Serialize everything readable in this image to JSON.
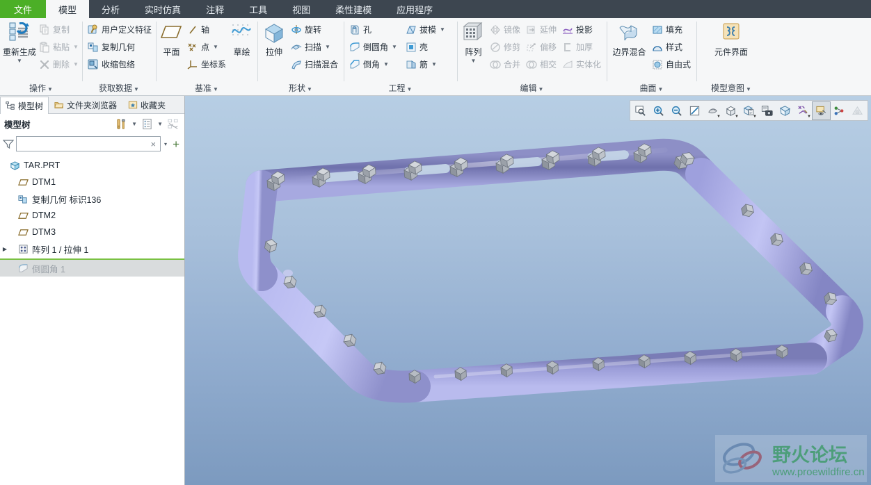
{
  "app": {
    "accent_green": "#4caf27",
    "tabbar_bg": "#3d4650",
    "ribbon_bg": "#f6f7f8",
    "insert_line_color": "#7ac143"
  },
  "tabs": [
    {
      "label": "文件",
      "kind": "file"
    },
    {
      "label": "模型",
      "kind": "active"
    },
    {
      "label": "分析",
      "kind": "normal"
    },
    {
      "label": "实时仿真",
      "kind": "normal"
    },
    {
      "label": "注释",
      "kind": "normal"
    },
    {
      "label": "工具",
      "kind": "normal"
    },
    {
      "label": "视图",
      "kind": "normal"
    },
    {
      "label": "柔性建模",
      "kind": "normal"
    },
    {
      "label": "应用程序",
      "kind": "normal"
    }
  ],
  "ribbon": {
    "groups": [
      {
        "name": "操作",
        "label": "操作",
        "big": {
          "label": "重新生成",
          "icon": "regenerate-icon",
          "has_caret": true
        },
        "items": [
          {
            "label": "复制",
            "icon": "copy-icon",
            "disabled": true,
            "caret": false
          },
          {
            "label": "粘贴",
            "icon": "paste-icon",
            "disabled": true,
            "caret": true
          },
          {
            "label": "删除",
            "icon": "delete-icon",
            "disabled": true,
            "caret": true
          }
        ]
      },
      {
        "name": "获取数据",
        "label": "获取数据",
        "items": [
          {
            "label": "用户定义特征",
            "icon": "udf-icon",
            "disabled": false,
            "caret": false
          },
          {
            "label": "复制几何",
            "icon": "copy-geometry-icon",
            "disabled": false,
            "caret": false
          },
          {
            "label": "收缩包络",
            "icon": "shrinkwrap-icon",
            "disabled": false,
            "caret": false
          }
        ]
      },
      {
        "name": "基准",
        "label": "基准",
        "big": {
          "label": "平面",
          "icon": "datum-plane-icon",
          "has_caret": false
        },
        "items": [
          {
            "label": "轴",
            "icon": "datum-axis-icon",
            "disabled": false,
            "caret": false
          },
          {
            "label": "点",
            "icon": "datum-point-icon",
            "disabled": false,
            "caret": true
          },
          {
            "label": "坐标系",
            "icon": "coordinate-system-icon",
            "disabled": false,
            "caret": false
          }
        ],
        "big2": {
          "label": "草绘",
          "icon": "sketch-icon",
          "has_caret": false
        }
      },
      {
        "name": "形状",
        "label": "形状",
        "big": {
          "label": "拉伸",
          "icon": "extrude-icon",
          "has_caret": false
        },
        "items": [
          {
            "label": "旋转",
            "icon": "revolve-icon",
            "disabled": false,
            "caret": false
          },
          {
            "label": "扫描",
            "icon": "sweep-icon",
            "disabled": false,
            "caret": true
          },
          {
            "label": "扫描混合",
            "icon": "swept-blend-icon",
            "disabled": false,
            "caret": false
          }
        ]
      },
      {
        "name": "工程",
        "label": "工程",
        "items_left": [
          {
            "label": "孔",
            "icon": "hole-icon",
            "disabled": false,
            "caret": false
          },
          {
            "label": "倒圆角",
            "icon": "round-icon",
            "disabled": false,
            "caret": true
          },
          {
            "label": "倒角",
            "icon": "chamfer-icon",
            "disabled": false,
            "caret": true
          }
        ],
        "items_right": [
          {
            "label": "拔模",
            "icon": "draft-icon",
            "disabled": false,
            "caret": true
          },
          {
            "label": "壳",
            "icon": "shell-icon",
            "disabled": false,
            "caret": false
          },
          {
            "label": "筋",
            "icon": "rib-icon",
            "disabled": false,
            "caret": true
          }
        ]
      },
      {
        "name": "编辑",
        "label": "编辑",
        "big": {
          "label": "阵列",
          "icon": "pattern-icon",
          "has_caret": true
        },
        "items_c1": [
          {
            "label": "镜像",
            "icon": "mirror-icon",
            "disabled": true,
            "caret": false
          },
          {
            "label": "修剪",
            "icon": "trim-icon",
            "disabled": true,
            "caret": false
          },
          {
            "label": "合并",
            "icon": "merge-icon",
            "disabled": true,
            "caret": false
          }
        ],
        "items_c2": [
          {
            "label": "延伸",
            "icon": "extend-icon",
            "disabled": true,
            "caret": false
          },
          {
            "label": "偏移",
            "icon": "offset-icon",
            "disabled": true,
            "caret": false
          },
          {
            "label": "相交",
            "icon": "intersect-icon",
            "disabled": true,
            "caret": false
          }
        ],
        "items_c3": [
          {
            "label": "投影",
            "icon": "project-icon",
            "disabled": false,
            "caret": false
          },
          {
            "label": "加厚",
            "icon": "thicken-icon",
            "disabled": true,
            "caret": false
          },
          {
            "label": "实体化",
            "icon": "solidify-icon",
            "disabled": true,
            "caret": false
          }
        ]
      },
      {
        "name": "曲面",
        "label": "曲面",
        "big": {
          "label": "边界混合",
          "icon": "boundary-blend-icon",
          "has_caret": false
        },
        "items": [
          {
            "label": "填充",
            "icon": "fill-icon",
            "disabled": false,
            "caret": false
          },
          {
            "label": "样式",
            "icon": "style-icon",
            "disabled": false,
            "caret": false
          },
          {
            "label": "自由式",
            "icon": "freestyle-icon",
            "disabled": false,
            "caret": false
          }
        ]
      },
      {
        "name": "模型意图",
        "label": "模型意图",
        "big": {
          "label": "元件界面",
          "icon": "component-interface-icon",
          "has_caret": false
        }
      }
    ]
  },
  "navpanel": {
    "tabs": [
      {
        "label": "模型树",
        "icon": "model-tree-icon",
        "active": true
      },
      {
        "label": "文件夹浏览器",
        "icon": "folder-browser-icon",
        "active": false
      },
      {
        "label": "收藏夹",
        "icon": "favorites-icon",
        "active": false
      }
    ],
    "header": {
      "title": "模型树",
      "tools_icon": "tools-settings-icon",
      "display_icon": "tree-columns-icon",
      "hide_tree_icon": "tree-hide-icon"
    },
    "filter": {
      "icon": "filter-funnel-icon",
      "value": "",
      "placeholder": "",
      "clear_label": "×",
      "caret_label": "▾",
      "add_label": "+"
    },
    "tree": [
      {
        "label": "TAR.PRT",
        "icon": "part-icon",
        "depth": 0,
        "arrow": false,
        "inactive": false,
        "selected": false
      },
      {
        "label": "DTM1",
        "icon": "datum-plane-icon",
        "depth": 1,
        "arrow": false,
        "inactive": false,
        "selected": false
      },
      {
        "label": "复制几何 标识136",
        "icon": "copy-geometry-icon",
        "depth": 1,
        "arrow": false,
        "inactive": false,
        "selected": false
      },
      {
        "label": "DTM2",
        "icon": "datum-plane-icon",
        "depth": 1,
        "arrow": false,
        "inactive": false,
        "selected": false
      },
      {
        "label": "DTM3",
        "icon": "datum-plane-icon",
        "depth": 1,
        "arrow": false,
        "inactive": false,
        "selected": false
      },
      {
        "label": "阵列 1 / 拉伸 1",
        "icon": "pattern-icon",
        "depth": 1,
        "arrow": true,
        "inactive": false,
        "selected": false
      }
    ],
    "insert_here": true,
    "tree_after_insert": [
      {
        "label": "倒圆角 1",
        "icon": "round-icon",
        "depth": 1,
        "arrow": false,
        "inactive": true,
        "selected": true
      }
    ]
  },
  "graphics_toolbar": {
    "buttons": [
      {
        "icon": "refit-icon",
        "state": "normal",
        "caret": false
      },
      {
        "icon": "zoom-in-icon",
        "state": "normal",
        "caret": false
      },
      {
        "icon": "zoom-out-icon",
        "state": "normal",
        "caret": false
      },
      {
        "icon": "repaint-icon",
        "state": "normal",
        "caret": false
      },
      {
        "icon": "spin-center-icon",
        "state": "normal",
        "caret": true
      },
      {
        "icon": "display-style-icon",
        "state": "normal",
        "caret": true
      },
      {
        "icon": "layer-display-icon",
        "state": "normal",
        "caret": true
      },
      {
        "icon": "saved-views-icon",
        "state": "normal",
        "caret": false
      },
      {
        "icon": "perspective-view-icon",
        "state": "normal",
        "caret": false
      },
      {
        "icon": "datum-display-filters-icon",
        "state": "normal",
        "caret": true
      },
      {
        "icon": "annotation-display-icon",
        "state": "on",
        "caret": false
      },
      {
        "icon": "point-display-icon",
        "state": "normal",
        "caret": false
      },
      {
        "icon": "appearance-gallery-icon",
        "state": "disabled",
        "caret": false
      }
    ]
  },
  "viewport": {
    "background_top": "#b7cee4",
    "background_bottom": "#7c9abf",
    "model": {
      "name": "rounded-rectangular-frame",
      "body_color_light": "#c2c4ef",
      "body_color_dark": "#7a7cb8",
      "feature_color": "#9ba0ae"
    }
  },
  "watermark": {
    "title": "野火论坛",
    "url": "www.proewildfire.cn",
    "title_color": "#2e9e4f",
    "url_color": "#2e9e4f",
    "logo_icon": "butterfly-logo-icon"
  }
}
